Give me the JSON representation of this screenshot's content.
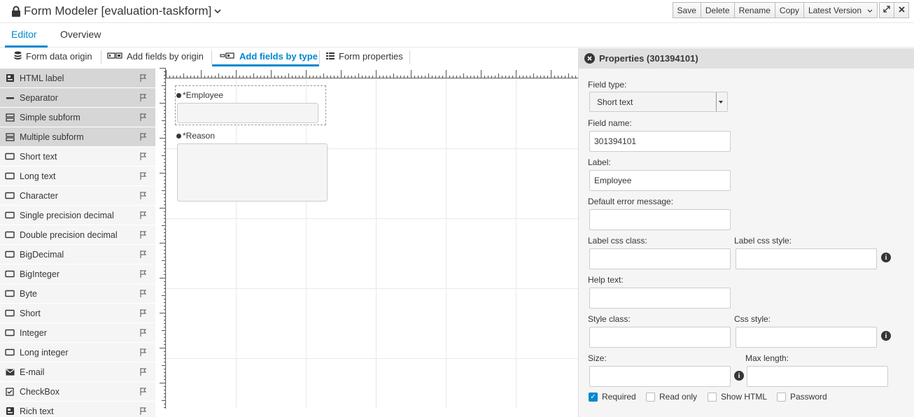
{
  "header": {
    "title": "Form Modeler [evaluation-taskform]",
    "buttons": [
      "Save",
      "Delete",
      "Rename",
      "Copy"
    ],
    "version_label": "Latest Version"
  },
  "tabs": [
    {
      "label": "Editor",
      "active": true
    },
    {
      "label": "Overview",
      "active": false
    }
  ],
  "subtabs": [
    {
      "label": "Form data origin",
      "icon": "database-icon"
    },
    {
      "label": "Add fields by origin",
      "icon": "fields-origin-icon"
    },
    {
      "label": "Add fields by type",
      "icon": "fields-type-icon",
      "active": true
    },
    {
      "label": "Form properties",
      "icon": "list-icon"
    }
  ],
  "palette": [
    {
      "label": "HTML label",
      "icon": "html-icon",
      "dark": true
    },
    {
      "label": "Separator",
      "icon": "separator-icon",
      "dark": true
    },
    {
      "label": "Simple subform",
      "icon": "subform-icon",
      "dark": true
    },
    {
      "label": "Multiple subform",
      "icon": "subform-icon",
      "dark": true
    },
    {
      "label": "Short text",
      "icon": "textbox-icon"
    },
    {
      "label": "Long text",
      "icon": "textbox-icon"
    },
    {
      "label": "Character",
      "icon": "textbox-icon"
    },
    {
      "label": "Single precision decimal",
      "icon": "textbox-icon"
    },
    {
      "label": "Double precision decimal",
      "icon": "textbox-icon"
    },
    {
      "label": "BigDecimal",
      "icon": "textbox-icon"
    },
    {
      "label": "BigInteger",
      "icon": "textbox-icon"
    },
    {
      "label": "Byte",
      "icon": "textbox-icon"
    },
    {
      "label": "Short",
      "icon": "textbox-icon"
    },
    {
      "label": "Integer",
      "icon": "textbox-icon"
    },
    {
      "label": "Long integer",
      "icon": "textbox-icon"
    },
    {
      "label": "E-mail",
      "icon": "envelope-icon"
    },
    {
      "label": "CheckBox",
      "icon": "checkbox-icon"
    },
    {
      "label": "Rich text",
      "icon": "html-icon"
    }
  ],
  "canvas": {
    "employee_label": "*Employee",
    "reason_label": "*Reason"
  },
  "properties": {
    "title": "Properties (301394101)",
    "field_type_label": "Field type:",
    "field_type_value": "Short text",
    "field_name_label": "Field name:",
    "field_name_value": "301394101",
    "label_label": "Label:",
    "label_value": "Employee",
    "default_error_label": "Default error message:",
    "label_css_class_label": "Label css class:",
    "label_css_style_label": "Label css style:",
    "help_text_label": "Help text:",
    "style_class_label": "Style class:",
    "css_style_label": "Css style:",
    "size_label": "Size:",
    "max_length_label": "Max length:",
    "checks": [
      {
        "label": "Required",
        "checked": true
      },
      {
        "label": "Read only",
        "checked": false
      },
      {
        "label": "Show HTML",
        "checked": false
      },
      {
        "label": "Password",
        "checked": false
      }
    ]
  },
  "colors": {
    "accent": "#0088ce",
    "text": "#363636"
  }
}
